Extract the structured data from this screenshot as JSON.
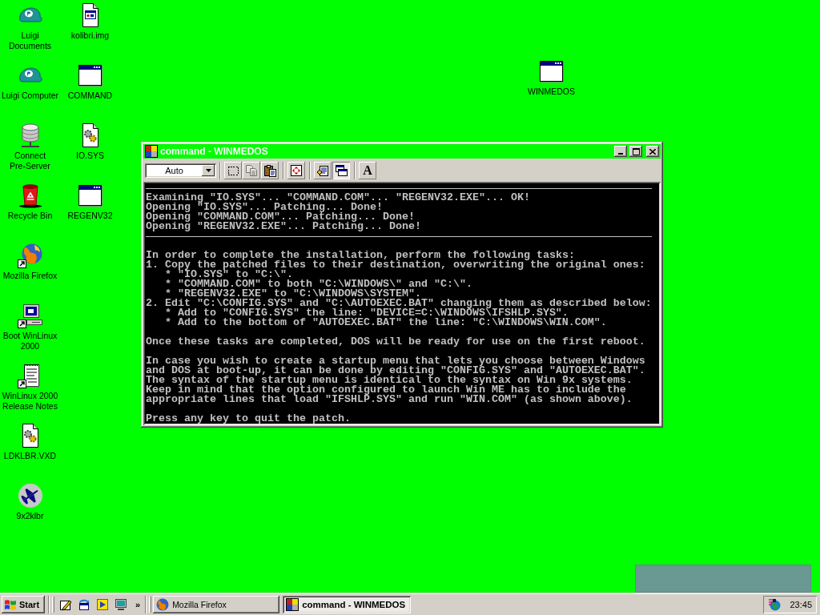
{
  "desktop": {
    "icon_columns": [
      [
        {
          "label": "Luigi Documents",
          "kind": "cap",
          "shortcut": false
        },
        {
          "label": "Luigi Computer",
          "kind": "cap",
          "shortcut": false
        },
        {
          "label": "Connect Pre-Server",
          "kind": "server",
          "shortcut": false
        },
        {
          "label": "Recycle Bin",
          "kind": "recycle-bin",
          "shortcut": false
        },
        {
          "label": "Mozilla Firefox",
          "kind": "browser",
          "shortcut": true
        },
        {
          "label": "Boot WinLinux 2000",
          "kind": "computer",
          "shortcut": true
        },
        {
          "label": "WinLinux 2000 Release Notes",
          "kind": "notes",
          "shortcut": true
        },
        {
          "label": "LDKLBR.VXD",
          "kind": "system-file",
          "shortcut": false
        },
        {
          "label": "9x2klbr",
          "kind": "airplane",
          "shortcut": false
        }
      ],
      [
        {
          "label": "kolibri.img",
          "kind": "image-file",
          "shortcut": false
        },
        {
          "label": "COMMAND",
          "kind": "program",
          "shortcut": false
        },
        {
          "label": "IO.SYS",
          "kind": "system-file",
          "shortcut": false
        },
        {
          "label": "REGENV32",
          "kind": "program",
          "shortcut": false
        }
      ]
    ],
    "loose_icons": [
      {
        "label": "WINMEDOS",
        "kind": "program",
        "shortcut": false
      }
    ]
  },
  "window": {
    "title": "command - WINMEDOS",
    "font_size_dropdown": {
      "value": "Auto"
    },
    "toolbar_groups": [
      {
        "buttons": [
          {
            "kind": "mark",
            "pressed": false,
            "disabled": false
          },
          {
            "kind": "copy",
            "pressed": false,
            "disabled": true
          },
          {
            "kind": "paste",
            "pressed": false,
            "disabled": false
          }
        ]
      },
      {
        "buttons": [
          {
            "kind": "fullscreen",
            "pressed": false,
            "disabled": false
          }
        ]
      },
      {
        "buttons": [
          {
            "kind": "properties",
            "pressed": false,
            "disabled": false
          },
          {
            "kind": "background",
            "pressed": true,
            "disabled": false
          }
        ]
      },
      {
        "buttons": [
          {
            "kind": "font",
            "label": "A",
            "pressed": false,
            "disabled": false
          }
        ]
      }
    ],
    "console": {
      "lines": [
        {
          "kind": "rule"
        },
        {
          "kind": "text",
          "text": "Examining \"IO.SYS\"... \"COMMAND.COM\"... \"REGENV32.EXE\"... OK!"
        },
        {
          "kind": "text",
          "text": "Opening \"IO.SYS\"... Patching... Done!"
        },
        {
          "kind": "text",
          "text": "Opening \"COMMAND.COM\"... Patching... Done!"
        },
        {
          "kind": "text",
          "text": "Opening \"REGENV32.EXE\"... Patching... Done!"
        },
        {
          "kind": "rule"
        },
        {
          "kind": "blank"
        },
        {
          "kind": "text",
          "text": "In order to complete the installation, perform the following tasks:"
        },
        {
          "kind": "text",
          "text": "1. Copy the patched files to their destination, overwriting the original ones:",
          "children": [
            {
              "kind": "text",
              "text": "* \"IO.SYS\" to \"C:\\\"."
            },
            {
              "kind": "text",
              "text": "* \"COMMAND.COM\" to both \"C:\\WINDOWS\\\" and \"C:\\\"."
            },
            {
              "kind": "text",
              "text": "* \"REGENV32.EXE\" to \"C:\\WINDOWS\\SYSTEM\"."
            }
          ]
        },
        {
          "kind": "text",
          "text": "2. Edit \"C:\\CONFIG.SYS\" and \"C:\\AUTOEXEC.BAT\" changing them as described below:",
          "children": [
            {
              "kind": "text",
              "text": "* Add to \"CONFIG.SYS\" the line: \"DEVICE=C:\\WINDOWS\\IFSHLP.SYS\"."
            },
            {
              "kind": "text",
              "text": "* Add to the bottom of \"AUTOEXEC.BAT\" the line: \"C:\\WINDOWS\\WIN.COM\"."
            }
          ]
        },
        {
          "kind": "blank"
        },
        {
          "kind": "text",
          "text": "Once these tasks are completed, DOS will be ready for use on the first reboot."
        },
        {
          "kind": "blank"
        },
        {
          "kind": "text",
          "text": "In case you wish to create a startup menu that lets you choose between Windows\nand DOS at boot-up, it can be done by editing \"CONFIG.SYS\" and \"AUTOEXEC.BAT\".\nThe syntax of the startup menu is identical to the syntax on Win 9x systems.\nKeep in mind that the option configured to launch Win ME has to include the\nappropriate lines that load \"IFSHLP.SYS\" and run \"WIN.COM\" (as shown above)."
        },
        {
          "kind": "blank"
        },
        {
          "kind": "text",
          "text": "Press any key to quit the patch."
        }
      ]
    }
  },
  "taskbar": {
    "start": "Start",
    "quick_launch": [
      {
        "kind": "desktop"
      },
      {
        "kind": "channels"
      },
      {
        "kind": "media"
      },
      {
        "kind": "display"
      }
    ],
    "more": "»",
    "tasks": [
      {
        "label": "Mozilla Firefox",
        "kind": "browser",
        "selected": false
      },
      {
        "label": "command - WINMEDOS",
        "kind": "dos",
        "selected": true
      }
    ],
    "clock": "23:45"
  }
}
